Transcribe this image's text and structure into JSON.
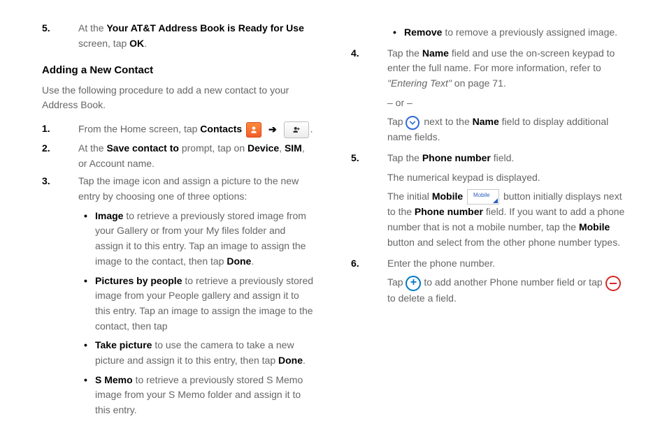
{
  "left": {
    "step5_pre": "At the ",
    "step5_bold1": "Your AT&T Address Book is Ready for Use",
    "step5_mid": " screen, tap ",
    "step5_bold2": "OK",
    "step5_post": ".",
    "heading": "Adding a New Contact",
    "intro": "Use the following procedure to add a new contact to your Address Book.",
    "step1_pre": "From the Home screen, tap ",
    "step1_contacts": "Contacts",
    "arrow": "➔",
    "step1_post": ".",
    "step2_pre": "At the ",
    "step2_bold": "Save contact to",
    "step2_mid": " prompt, tap on ",
    "step2_dev": "Device",
    "step2_sim": "SIM",
    "step2_acc": " or Account name.",
    "step3": "Tap the image icon and assign a picture to the new entry by choosing one of three options:",
    "b_image_bold": "Image",
    "b_image_txt": " to retrieve a previously stored image from your Gallery or from your My files folder and assign it to this entry. Tap an image to assign the image to the contact, then tap ",
    "b_image_done": "Done",
    "b_image_post": ".",
    "b_pbp_bold": "Pictures by people",
    "b_pbp_txt": " to retrieve a previously stored image from your People gallery and assign it to this entry. Tap an image to assign the image to the contact, then tap ",
    "b_tp_bold": "Take picture",
    "b_tp_txt": " to use the camera to take a new picture and assign it to this entry, then tap ",
    "b_tp_done": "Done",
    "b_tp_post": ".",
    "b_sm_bold": "S Memo",
    "b_sm_txt": " to retrieve a previously stored S Memo image from your S Memo folder and assign it to this entry."
  },
  "right": {
    "b_rm_bold": "Remove",
    "b_rm_txt": " to remove a previously assigned image.",
    "s4_pre": "Tap the ",
    "s4_name": "Name",
    "s4_mid": " field and use the on-screen keypad to enter the full name. For more information, refer to ",
    "s4_ref": "\"Entering Text\"",
    "s4_page": " on page 71.",
    "s4_or": "– or –",
    "s4_tap": "Tap ",
    "s4_next": " next to the ",
    "s4_name2": "Name",
    "s4_tail": " field to display additional name fields.",
    "s5_pre": "Tap the ",
    "s5_pn": "Phone number",
    "s5_post": " field.",
    "s5_desc1": "The numerical keypad is displayed.",
    "s5_init": "The initial ",
    "s5_mobile": "Mobile",
    "s5_mobile_btn": "Mobile",
    "s5_btn_post": " button initially displays next to the ",
    "s5_pn2": "Phone number",
    "s5_field_post": " field.",
    "s5_want": "If you want to add a phone number that is not a mobile number, tap the ",
    "s5_mobile2": "Mobile",
    "s5_btnmid": " button and select from the other phone number types.",
    "s6_pre": "Enter the phone number.",
    "s6_tap": "Tap ",
    "s6_add": " to add another Phone number field or tap ",
    "s6_del": " to delete a field."
  }
}
